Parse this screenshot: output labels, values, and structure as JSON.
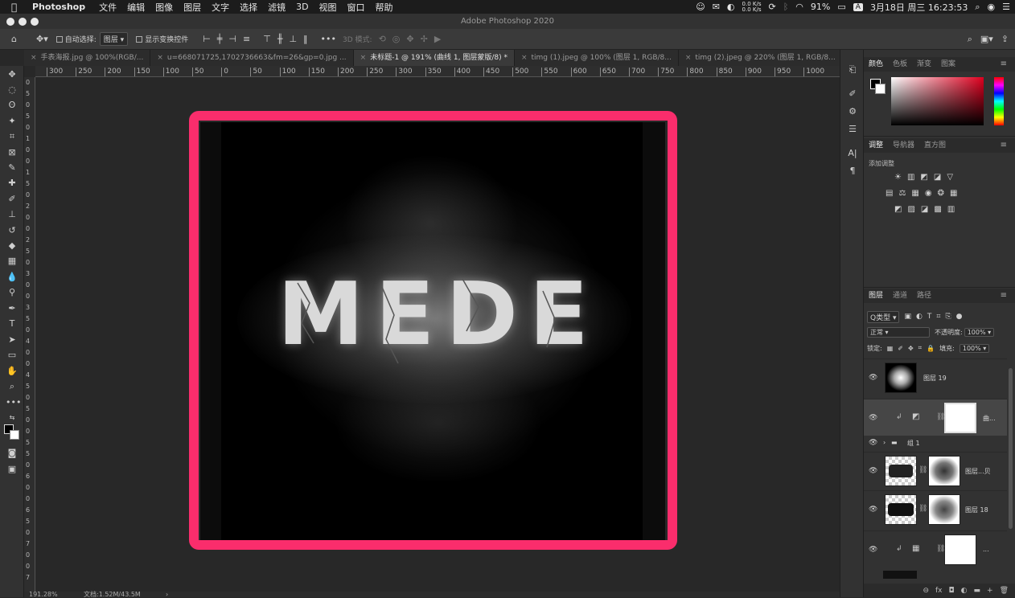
{
  "menubar": {
    "apple": "",
    "app": "Photoshop",
    "items": [
      "文件",
      "编辑",
      "图像",
      "图层",
      "文字",
      "选择",
      "滤镜",
      "3D",
      "视图",
      "窗口",
      "帮助"
    ],
    "net_up": "0.0 K/s",
    "net_down": "0.0 K/s",
    "battery": "91%",
    "input": "A",
    "datetime": "3月18日 周三  16:23:53"
  },
  "titlebar": {
    "title": "Adobe Photoshop 2020"
  },
  "options": {
    "auto_select_label": "自动选择:",
    "auto_select_value": "图层",
    "show_transform_label": "显示变换控件",
    "mode3d_label": "3D 模式:",
    "more": "•••"
  },
  "tabs": [
    {
      "label": "手表海报.jpg @ 100%(RGB/...",
      "active": false
    },
    {
      "label": "u=668071725,1702736663&fm=26&gp=0.jpg ...",
      "active": false
    },
    {
      "label": "未标题-1 @ 191% (曲线 1, 图层蒙版/8) *",
      "active": true
    },
    {
      "label": "timg (1).jpeg @ 100% (图层 1, RGB/8...",
      "active": false
    },
    {
      "label": "timg (2).jpeg @ 220% (图层 1, RGB/8...",
      "active": false
    }
  ],
  "ruler": {
    "h_ticks": [
      "300",
      "250",
      "200",
      "150",
      "100",
      "50",
      "0",
      "50",
      "100",
      "150",
      "200",
      "250",
      "300",
      "350",
      "400",
      "450",
      "500",
      "550",
      "600",
      "650",
      "700",
      "750",
      "800",
      "850",
      "900",
      "950",
      "1000"
    ],
    "v_ticks": [
      "0",
      "5",
      "0",
      "5",
      "0",
      "1",
      "0",
      "0",
      "1",
      "5",
      "0",
      "2",
      "0",
      "0",
      "2",
      "5",
      "0",
      "3",
      "0",
      "0",
      "3",
      "5",
      "0",
      "4",
      "0",
      "0",
      "4",
      "5",
      "0",
      "5",
      "0",
      "0",
      "5",
      "5",
      "0",
      "6",
      "0",
      "0",
      "6",
      "5",
      "0",
      "7",
      "0",
      "0",
      "7"
    ]
  },
  "canvas": {
    "text": "MEDE"
  },
  "status": {
    "zoom": "191.28%",
    "doc": "文档:1.52M/43.5M",
    "arrow": "›"
  },
  "color_panel": {
    "tabs": [
      "颜色",
      "色板",
      "渐变",
      "图案"
    ]
  },
  "adjust_panel": {
    "tabs": [
      "调整",
      "导航器",
      "直方图"
    ],
    "label": "添加调整",
    "row1": [
      "☀",
      "▥",
      "◩",
      "◪",
      "▽"
    ],
    "row2": [
      "▤",
      "⚖",
      "▦",
      "◉",
      "❂",
      "▦"
    ],
    "row3": [
      "◩",
      "▨",
      "◪",
      "▩",
      "▥"
    ]
  },
  "layers_panel": {
    "tabs": [
      "图层",
      "通道",
      "路径"
    ],
    "filter_label": "Q类型",
    "blend_mode": "正常",
    "opacity_label": "不透明度:",
    "opacity_value": "100%",
    "lock_label": "锁定:",
    "fill_label": "填充:",
    "fill_value": "100%",
    "layers": [
      {
        "name": "图层 19"
      },
      {
        "name": "曲..."
      },
      {
        "name": "组 1"
      },
      {
        "name": "图层...贝"
      },
      {
        "name": "图层 18"
      },
      {
        "name": "..."
      }
    ],
    "footer": [
      "⊖",
      "fx",
      "◘",
      "◐",
      "▬",
      "+",
      "🗑"
    ]
  },
  "colors": {
    "highlight": "#fa2d6c"
  }
}
